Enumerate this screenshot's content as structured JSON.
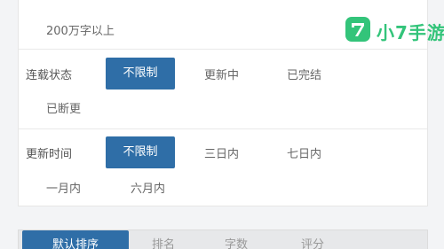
{
  "word_count_filter": {
    "faded_options": [
      "",
      "",
      ""
    ],
    "last_option": "200万字以上"
  },
  "status_filter": {
    "label": "连载状态",
    "options": [
      "不限制",
      "更新中",
      "已完结",
      "已断更"
    ],
    "selected": "不限制"
  },
  "update_time_filter": {
    "label": "更新时间",
    "options": [
      "不限制",
      "三日内",
      "七日内",
      "一月内",
      "六月内"
    ],
    "selected": "不限制"
  },
  "sort_tabs": [
    "默认排序",
    "排名",
    "字数",
    "评分"
  ],
  "sort_tabs_active": "默认排序",
  "watermark": {
    "text": "小7手游",
    "brand_color": "#33c47a"
  },
  "colors": {
    "accent": "#2f6ea7"
  }
}
